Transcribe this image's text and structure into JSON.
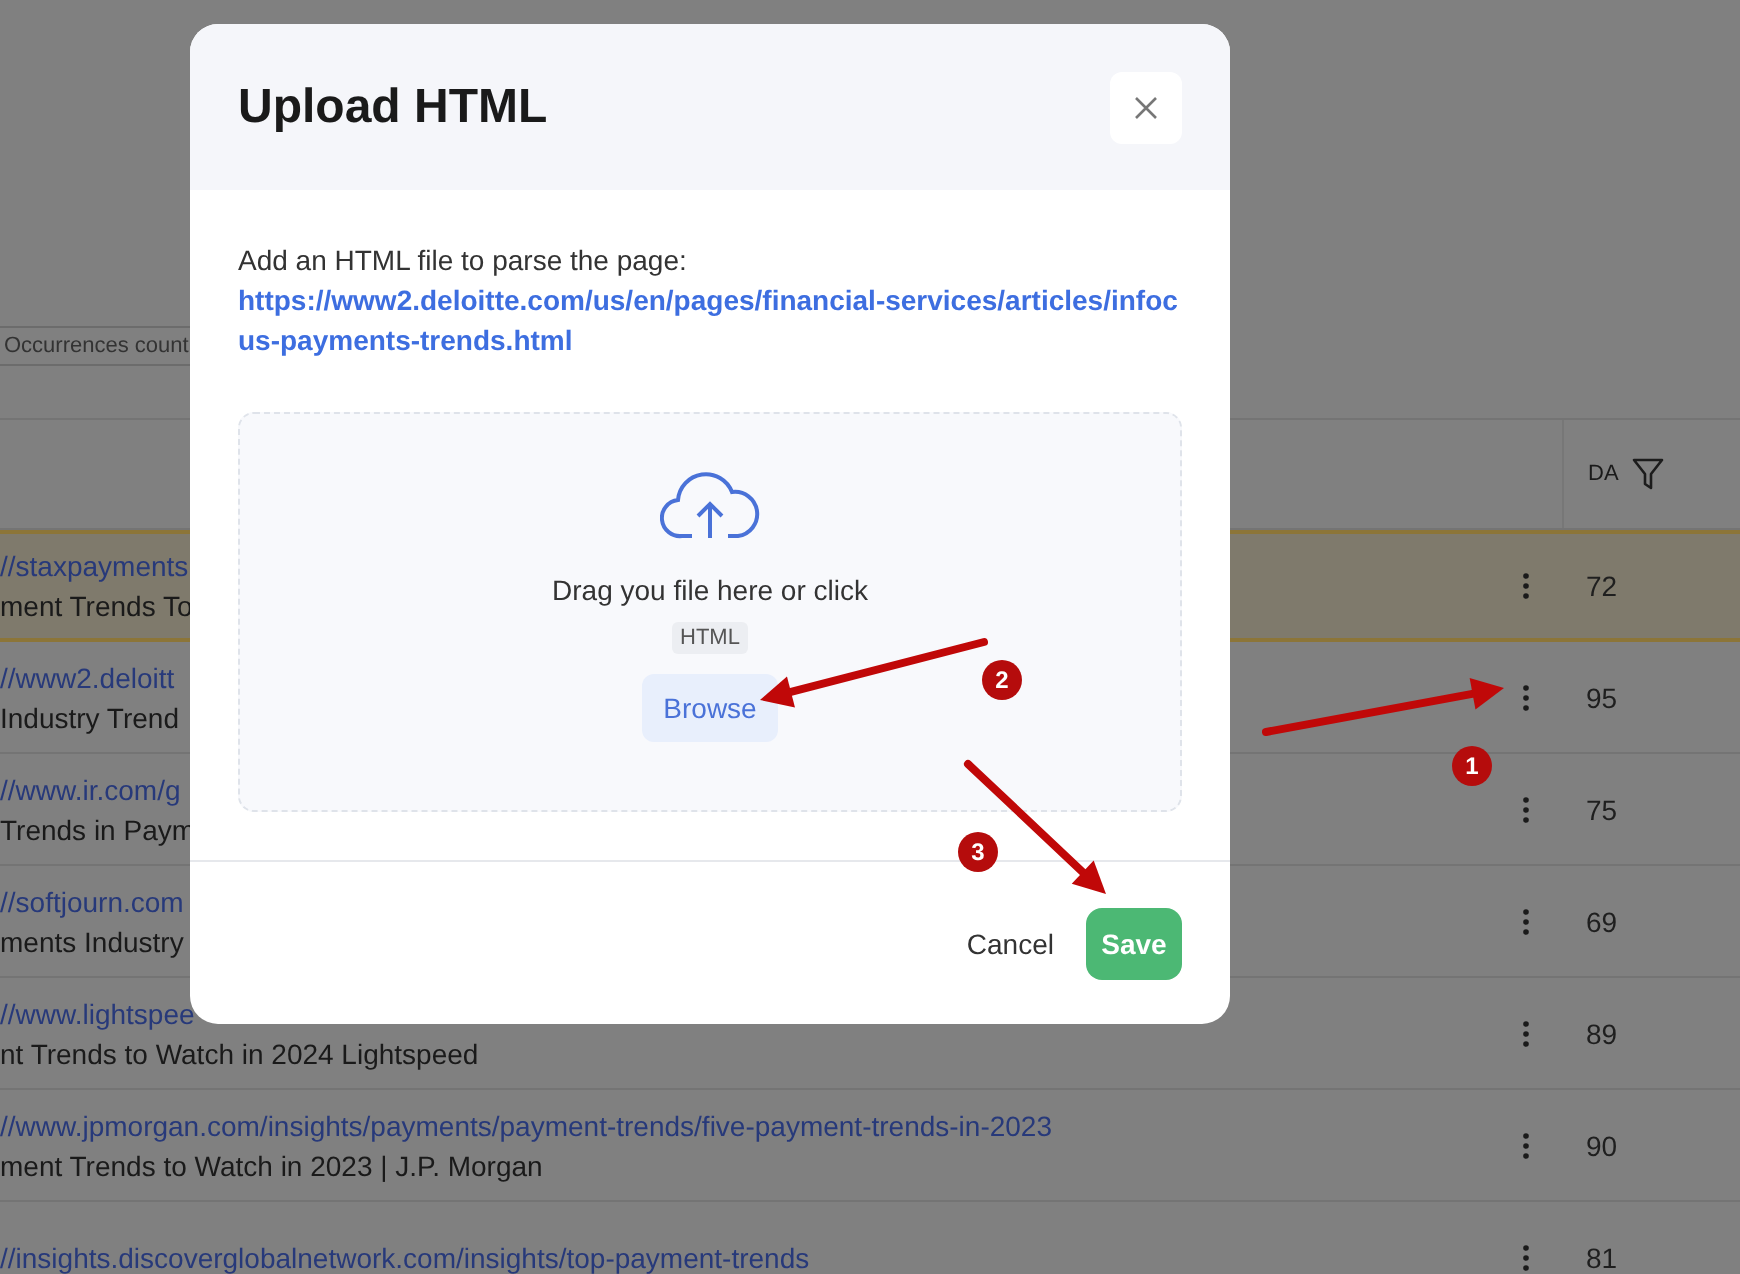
{
  "background_page": {
    "filter_chip": "Occurrences count",
    "table": {
      "columns": [
        {
          "label": "DA"
        }
      ],
      "rows": [
        {
          "url": "//staxpayments",
          "title": "ment Trends To",
          "da": "72",
          "highlighted": true
        },
        {
          "url": "//www2.deloitt",
          "title": " Industry Trend",
          "da": "95",
          "highlighted": false
        },
        {
          "url": "//www.ir.com/g",
          "title": " Trends in Paym",
          "da": "75",
          "highlighted": false
        },
        {
          "url": "//softjourn.com",
          "title": "ments Industry",
          "da": "69",
          "highlighted": false
        },
        {
          "url": "//www.lightspee",
          "title": "nt Trends to Watch in 2024 Lightspeed",
          "da": "89",
          "highlighted": false
        },
        {
          "url": "//www.jpmorgan.com/insights/payments/payment-trends/five-payment-trends-in-2023",
          "title": "ment Trends to Watch in 2023 | J.P. Morgan",
          "da": "90",
          "highlighted": false
        },
        {
          "url": "//insights.discoverglobalnetwork.com/insights/top-payment-trends",
          "da": "81",
          "highlighted": false
        }
      ]
    }
  },
  "dialog": {
    "title": "Upload HTML",
    "instruction": "Add an HTML file to parse the page:",
    "url": "https://www2.deloitte.com/us/en/pages/financial-services/articles/infocus-payments-trends.html",
    "dropzone": {
      "prompt": "Drag you file here or click",
      "file_type": "HTML",
      "browse_button": "Browse"
    },
    "buttons": [
      {
        "label": "Cancel",
        "kind": "secondary"
      },
      {
        "label": "Save",
        "kind": "primary"
      }
    ]
  },
  "annotations": [
    {
      "number": "1"
    },
    {
      "number": "2"
    },
    {
      "number": "3"
    }
  ]
}
